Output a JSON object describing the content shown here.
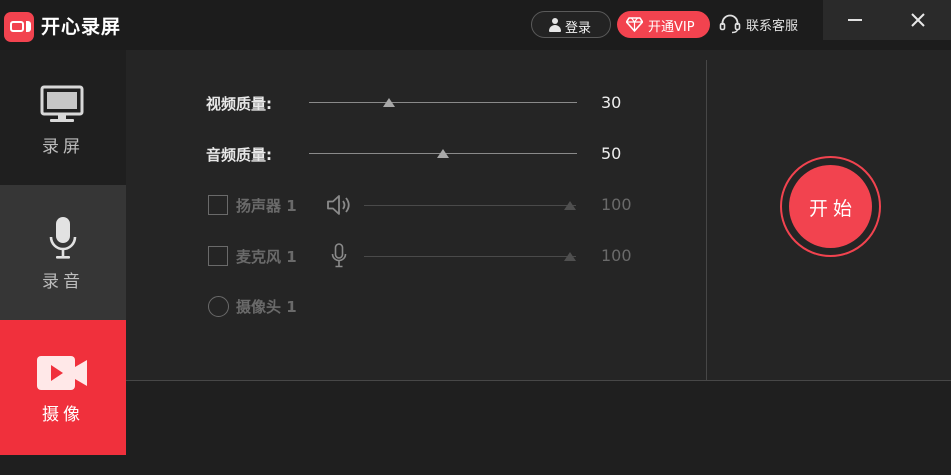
{
  "app": {
    "title": "开心录屏"
  },
  "header": {
    "login_label": "登录",
    "vip_label": "开通VIP",
    "service_label": "联系客服"
  },
  "sidebar": {
    "items": [
      {
        "label": "录屏",
        "icon": "monitor-icon",
        "active": false
      },
      {
        "label": "录音",
        "icon": "microphone-icon",
        "active": false
      },
      {
        "label": "摄像",
        "icon": "video-camera-icon",
        "active": true
      }
    ]
  },
  "settings": {
    "video_quality": {
      "label": "视频质量:",
      "value": "30",
      "level": 30
    },
    "audio_quality": {
      "label": "音频质量:",
      "value": "50",
      "level": 50
    },
    "speaker": {
      "label": "扬声器 1",
      "value": "100",
      "level": 100,
      "checked": false
    },
    "microphone": {
      "label": "麦克风 1",
      "value": "100",
      "level": 100,
      "checked": false
    },
    "camera": {
      "label": "摄像头 1",
      "selected": false
    }
  },
  "start": {
    "label": "开始"
  },
  "colors": {
    "accent": "#f2434f",
    "background": "#252525",
    "sidebar": "#1f1f1f"
  }
}
